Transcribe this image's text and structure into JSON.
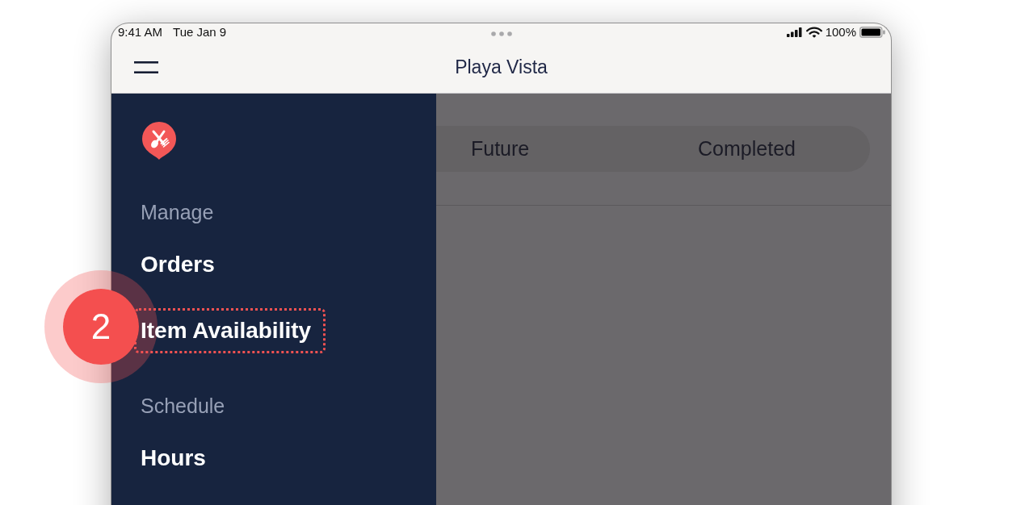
{
  "status_bar": {
    "time": "9:41 AM",
    "date": "Tue Jan 9",
    "battery": "100%"
  },
  "nav_bar": {
    "title": "Playa Vista"
  },
  "sidebar": {
    "sections": [
      {
        "heading": "Manage",
        "items": [
          {
            "label": "Orders"
          },
          {
            "label": "Item Availability",
            "callout": "2"
          }
        ]
      },
      {
        "heading": "Schedule",
        "items": [
          {
            "label": "Hours"
          }
        ]
      }
    ]
  },
  "content": {
    "tabs": [
      {
        "label": "Future",
        "selected": false
      },
      {
        "label": "Completed",
        "selected": false
      }
    ]
  }
}
